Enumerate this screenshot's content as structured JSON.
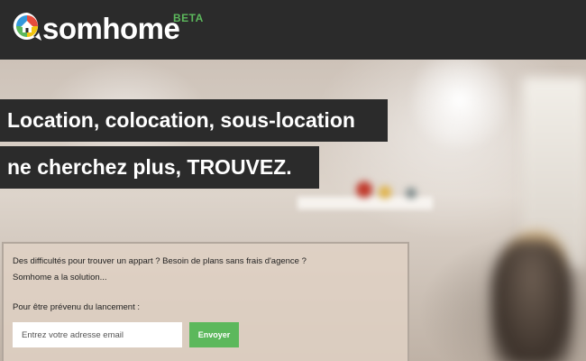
{
  "header": {
    "brand": "somhome",
    "badge": "BETA",
    "logo_icon": "house-chat-bubble-icon",
    "background_color": "#2b2b2b",
    "accent_color": "#5cb85c"
  },
  "hero": {
    "headline_line1": "Location, colocation, sous-location",
    "headline_line2": "ne cherchez plus, TROUVEZ."
  },
  "signup": {
    "intro_line1": "Des difficultés pour trouver un appart ? Besoin de plans sans frais d'agence ?",
    "intro_line2": "Somhome a la solution...",
    "prompt": "Pour être prévenu du lancement :",
    "email_placeholder": "Entrez votre adresse email",
    "email_value": "",
    "submit_label": "Envoyer"
  }
}
